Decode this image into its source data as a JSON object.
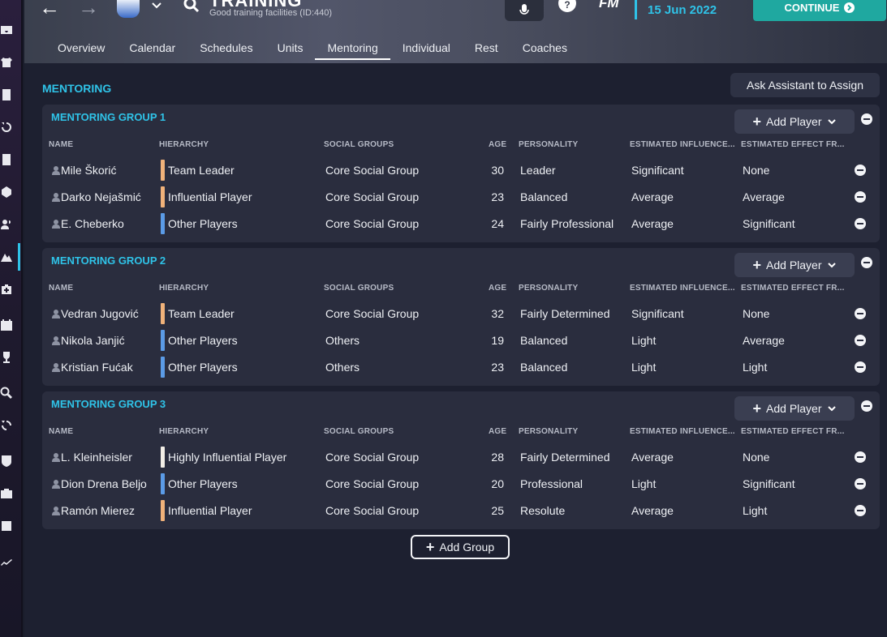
{
  "header": {
    "title": "TRAINING",
    "subtitle": "Good training facilities (ID:440)",
    "fm_label": "FM",
    "date": "15 Jun 2022",
    "continue_label": "CONTINUE"
  },
  "tabs": [
    {
      "label": "Overview"
    },
    {
      "label": "Calendar"
    },
    {
      "label": "Schedules"
    },
    {
      "label": "Units"
    },
    {
      "label": "Mentoring",
      "active": true
    },
    {
      "label": "Individual"
    },
    {
      "label": "Rest"
    },
    {
      "label": "Coaches"
    }
  ],
  "main": {
    "section_title": "MENTORING",
    "ask_button": "Ask Assistant to Assign",
    "add_player_label": "Add Player",
    "add_group_label": "Add Group",
    "columns": {
      "name": "NAME",
      "hierarchy": "HIERARCHY",
      "social": "SOCIAL GROUPS",
      "age": "AGE",
      "personality": "PERSONALITY",
      "influence": "ESTIMATED INFLUENCE...",
      "effect": "ESTIMATED EFFECT FR..."
    },
    "groups": [
      {
        "title": "MENTORING GROUP 1",
        "rows": [
          {
            "name": "Mile Škorić",
            "hierarchy": "Team Leader",
            "hcolor": "#f0b27a",
            "social": "Core Social Group",
            "age": "30",
            "personality": "Leader",
            "influence": "Significant",
            "effect": "None"
          },
          {
            "name": "Darko Nejašmić",
            "hierarchy": "Influential Player",
            "hcolor": "#f0b27a",
            "social": "Core Social Group",
            "age": "23",
            "personality": "Balanced",
            "influence": "Average",
            "effect": "Average"
          },
          {
            "name": "E. Cheberko",
            "hierarchy": "Other Players",
            "hcolor": "#5b9be6",
            "social": "Core Social Group",
            "age": "24",
            "personality": "Fairly Professional",
            "influence": "Average",
            "effect": "Significant"
          }
        ]
      },
      {
        "title": "MENTORING GROUP 2",
        "rows": [
          {
            "name": "Vedran Jugović",
            "hierarchy": "Team Leader",
            "hcolor": "#f0b27a",
            "social": "Core Social Group",
            "age": "32",
            "personality": "Fairly Determined",
            "influence": "Significant",
            "effect": "None"
          },
          {
            "name": "Nikola Janjić",
            "hierarchy": "Other Players",
            "hcolor": "#5b9be6",
            "social": "Others",
            "age": "19",
            "personality": "Balanced",
            "influence": "Light",
            "effect": "Average"
          },
          {
            "name": "Kristian Fućak",
            "hierarchy": "Other Players",
            "hcolor": "#5b9be6",
            "social": "Others",
            "age": "23",
            "personality": "Balanced",
            "influence": "Light",
            "effect": "Light"
          }
        ]
      },
      {
        "title": "MENTORING GROUP 3",
        "rows": [
          {
            "name": "L. Kleinheisler",
            "hierarchy": "Highly Influential Player",
            "hcolor": "#f2eee6",
            "social": "Core Social Group",
            "age": "28",
            "personality": "Fairly Determined",
            "influence": "Average",
            "effect": "None"
          },
          {
            "name": "Dion Drena Beljo",
            "hierarchy": "Other Players",
            "hcolor": "#5b9be6",
            "social": "Core Social Group",
            "age": "20",
            "personality": "Professional",
            "influence": "Light",
            "effect": "Significant"
          },
          {
            "name": "Ramón Mierez",
            "hierarchy": "Influential Player",
            "hcolor": "#f0b27a",
            "social": "Core Social Group",
            "age": "25",
            "personality": "Resolute",
            "influence": "Average",
            "effect": "Light"
          }
        ]
      }
    ]
  },
  "colors": {
    "accent": "#2fc3e8",
    "continue": "#1fa8a0"
  }
}
